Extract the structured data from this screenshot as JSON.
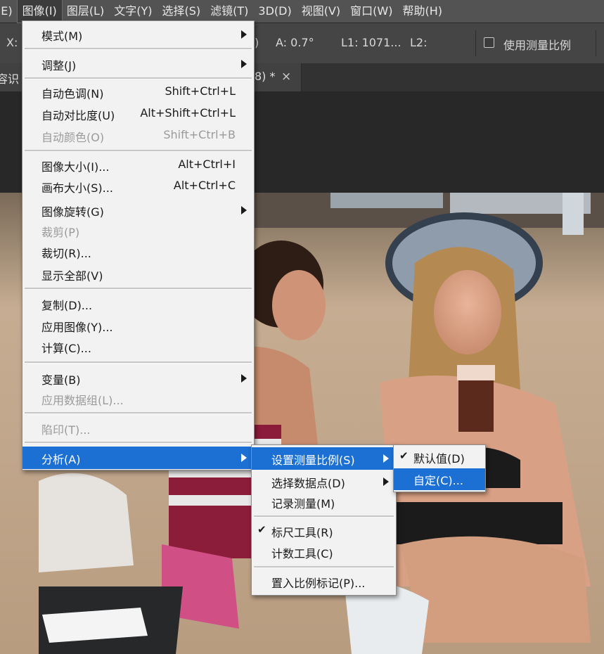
{
  "menubar": {
    "items": [
      {
        "label": "(E)"
      },
      {
        "label": "图像(I)"
      },
      {
        "label": "图层(L)"
      },
      {
        "label": "文字(Y)"
      },
      {
        "label": "选择(S)"
      },
      {
        "label": "滤镜(T)"
      },
      {
        "label": "3D(D)"
      },
      {
        "label": "视图(V)"
      },
      {
        "label": "窗口(W)"
      },
      {
        "label": "帮助(H)"
      }
    ]
  },
  "options_bar": {
    "x_label": "X:",
    "partial": ")",
    "a_value": "A:  0.7°",
    "l1_value": "L1:  1071...",
    "l2_label": "L2:",
    "scale_checkbox_label": "使用测量比例"
  },
  "document_tab": {
    "title_left": "容识",
    "title_right": "8) *",
    "close_glyph": "×"
  },
  "image_menu": {
    "items": [
      {
        "label": "模式(M)",
        "submenu": true
      },
      {
        "label": "调整(J)",
        "submenu": true
      },
      {
        "label": "自动色调(N)",
        "shortcut": "Shift+Ctrl+L"
      },
      {
        "label": "自动对比度(U)",
        "shortcut": "Alt+Shift+Ctrl+L"
      },
      {
        "label": "自动颜色(O)",
        "shortcut": "Shift+Ctrl+B",
        "disabled": true
      },
      {
        "label": "图像大小(I)...",
        "shortcut": "Alt+Ctrl+I"
      },
      {
        "label": "画布大小(S)...",
        "shortcut": "Alt+Ctrl+C"
      },
      {
        "label": "图像旋转(G)",
        "submenu": true
      },
      {
        "label": "裁剪(P)",
        "disabled": true
      },
      {
        "label": "裁切(R)..."
      },
      {
        "label": "显示全部(V)"
      },
      {
        "label": "复制(D)..."
      },
      {
        "label": "应用图像(Y)..."
      },
      {
        "label": "计算(C)..."
      },
      {
        "label": "变量(B)",
        "submenu": true
      },
      {
        "label": "应用数据组(L)...",
        "disabled": true
      },
      {
        "label": "陷印(T)...",
        "disabled": true
      },
      {
        "label": "分析(A)",
        "submenu": true,
        "highlighted": true
      }
    ]
  },
  "analysis_menu": {
    "items": [
      {
        "label": "设置测量比例(S)",
        "submenu": true,
        "highlighted": true
      },
      {
        "label": "选择数据点(D)",
        "submenu": true
      },
      {
        "label": "记录测量(M)"
      },
      {
        "label": "标尺工具(R)",
        "checked": true
      },
      {
        "label": "计数工具(C)"
      },
      {
        "label": "置入比例标记(P)..."
      }
    ]
  },
  "scale_menu": {
    "items": [
      {
        "label": "默认值(D)",
        "checked": true
      },
      {
        "label": "自定(C)...",
        "highlighted": true
      }
    ]
  },
  "check_glyph": "✔",
  "colors": {
    "menubar_bg": "#535353",
    "options_bg": "#454545",
    "menu_bg": "#f2f2f2",
    "highlight": "#1c70d4",
    "disabled_text": "#9a9a9a"
  }
}
